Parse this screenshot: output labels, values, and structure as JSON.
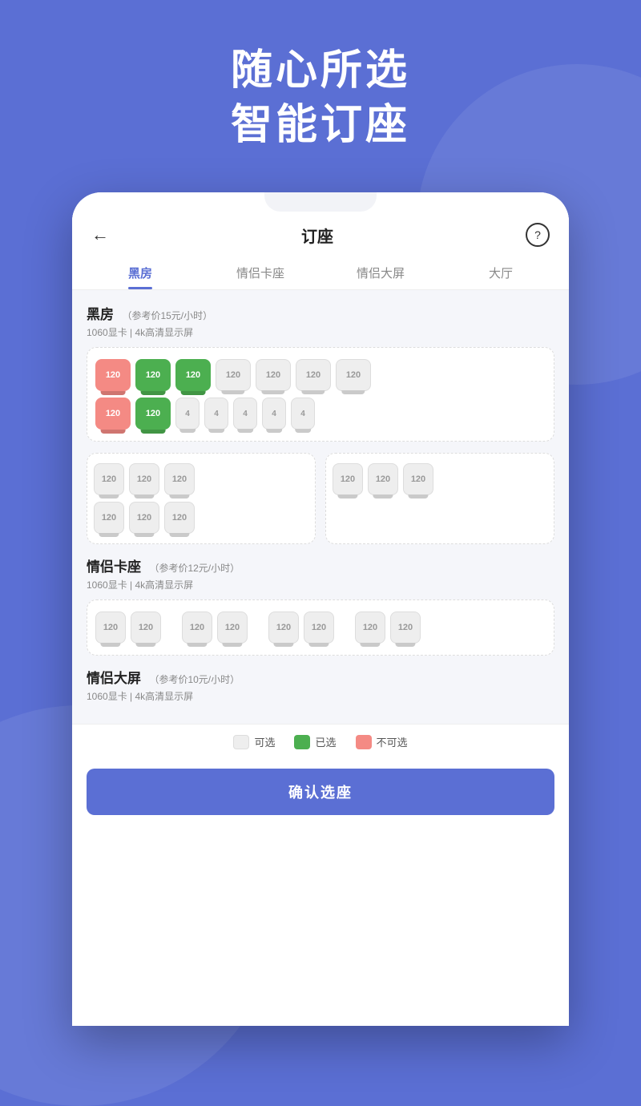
{
  "hero": {
    "line1": "随心所选",
    "line2": "智能订座"
  },
  "nav": {
    "back_icon": "←",
    "title": "订座",
    "help_icon": "?"
  },
  "tabs": [
    {
      "label": "黑房",
      "active": true
    },
    {
      "label": "情侣卡座",
      "active": false
    },
    {
      "label": "情侣大屏",
      "active": false
    },
    {
      "label": "大厅",
      "active": false
    }
  ],
  "sections": [
    {
      "id": "heifang",
      "title": "黑房",
      "price_note": "（参考价15元/小时）",
      "spec": "1060显卡  |  4k高清显示屏",
      "rows": [
        [
          "unavailable",
          "selected",
          "selected",
          "available",
          "available",
          "available",
          "available"
        ],
        [
          "unavailable",
          "selected",
          "available-sm",
          "available-sm",
          "available-sm",
          "available-sm",
          "available-sm"
        ]
      ],
      "seat_label": "120",
      "small_label": "4"
    },
    {
      "id": "heifang-sub",
      "grids": [
        {
          "rows": [
            [
              "available",
              "available",
              "available"
            ],
            [
              "available",
              "available",
              "available"
            ]
          ],
          "label": "120"
        },
        {
          "rows": [
            [
              "available",
              "available",
              "available"
            ],
            [
              "available",
              "available",
              "available"
            ]
          ],
          "label": "120"
        }
      ]
    },
    {
      "id": "qinglv-ka",
      "title": "情侣卡座",
      "price_note": "（参考价12元/小时）",
      "spec": "1060显卡  |  4k高清显示屏",
      "couple_row": [
        [
          "available",
          "available",
          "available",
          "available",
          "available",
          "available",
          "available",
          "available"
        ]
      ],
      "seat_label": "120"
    },
    {
      "id": "qinglv-da",
      "title": "情侣大屏",
      "price_note": "（参考价10元/小时）",
      "spec": "1060显卡  |  4k高清显示屏"
    }
  ],
  "legend": {
    "available_label": "可选",
    "selected_label": "已选",
    "unavailable_label": "不可选"
  },
  "confirm_btn": "确认选座"
}
